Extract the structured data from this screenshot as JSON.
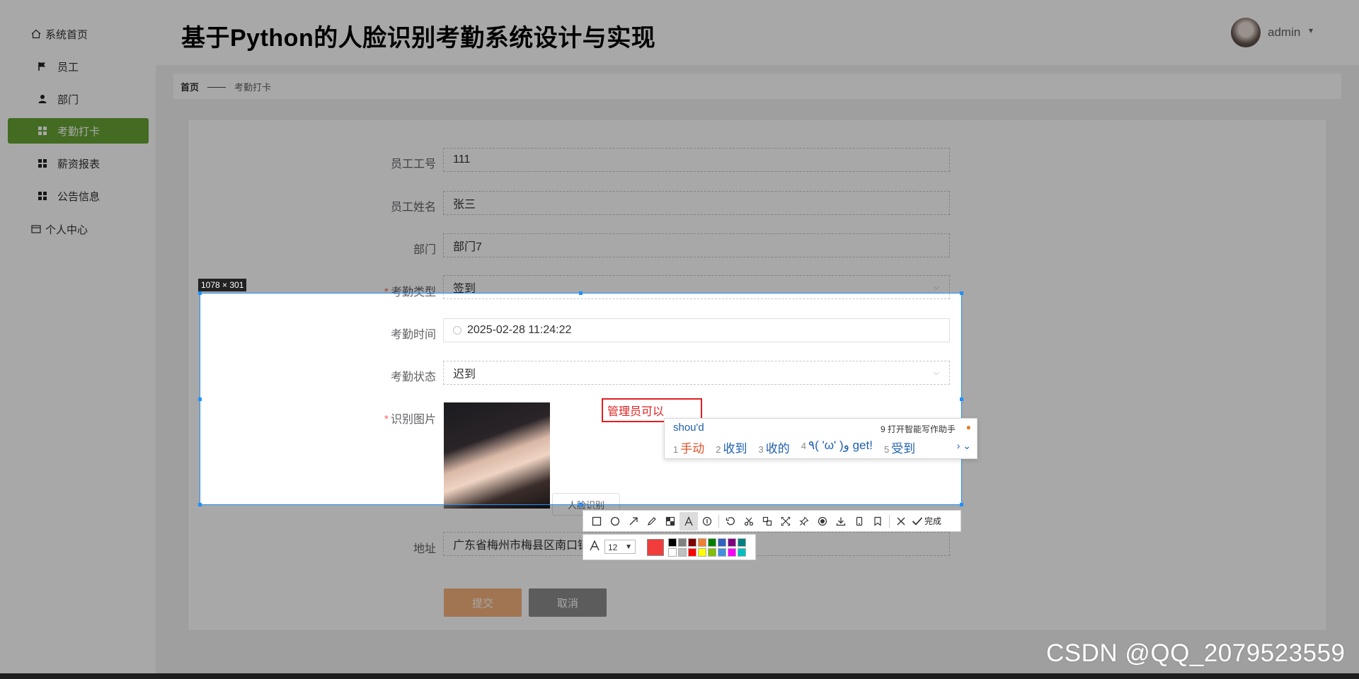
{
  "app_title": "基于Python的人脸识别考勤系统设计与实现",
  "user": {
    "name": "admin",
    "caret": "▾"
  },
  "sidebar": {
    "items": [
      {
        "label": "系统首页",
        "icon": "home-icon"
      },
      {
        "label": "员工",
        "icon": "flag-icon"
      },
      {
        "label": "部门",
        "icon": "user-icon"
      },
      {
        "label": "考勤打卡",
        "icon": "grid-icon",
        "active": true
      },
      {
        "label": "薪资报表",
        "icon": "grid-icon"
      },
      {
        "label": "公告信息",
        "icon": "grid-icon"
      },
      {
        "label": "个人中心",
        "icon": "card-icon"
      }
    ]
  },
  "breadcrumb": {
    "home": "首页",
    "separator": "——",
    "current": "考勤打卡"
  },
  "form": {
    "employee_no": {
      "label": "员工工号",
      "value": "111"
    },
    "employee_name": {
      "label": "员工姓名",
      "value": "张三"
    },
    "department": {
      "label": "部门",
      "value": "部门7"
    },
    "attendance_type": {
      "label": "考勤类型",
      "value": "签到",
      "required": "*"
    },
    "attendance_time": {
      "label": "考勤时间",
      "value": "2025-02-28 11:24:22"
    },
    "attendance_status": {
      "label": "考勤状态",
      "value": "迟到"
    },
    "recognition_image": {
      "label": "识别图片",
      "required": "*"
    },
    "face_button": "人脸识别",
    "address": {
      "label": "地址",
      "value": "广东省梅州市梅县区南口镇"
    },
    "submit": "提交",
    "cancel": "取消"
  },
  "capture_tool": {
    "size_badge": "1078 × 301",
    "annotation_text": "管理员可以",
    "done_label": "完成",
    "font_size": "12",
    "current_color": "#f23b3b",
    "palette": [
      "#000000",
      "#808080",
      "#800000",
      "#f08030",
      "#008000",
      "#3060c0",
      "#800080",
      "#008080",
      "#ffffff",
      "#c0c0c0",
      "#ff0000",
      "#ffff00",
      "#80c000",
      "#4090e0",
      "#ff00ff",
      "#00c0c0"
    ]
  },
  "ime": {
    "input": "shou'd",
    "hint": "9 打开智能写作助手",
    "candidates": [
      {
        "n": "1",
        "text": "手动"
      },
      {
        "n": "2",
        "text": "收到"
      },
      {
        "n": "3",
        "text": "收的"
      },
      {
        "n": "4",
        "text": "٩( 'ω' )و get!"
      },
      {
        "n": "5",
        "text": "受到"
      }
    ],
    "nav": "› ⌄"
  },
  "watermark": "CSDN @QQ_2079523559"
}
